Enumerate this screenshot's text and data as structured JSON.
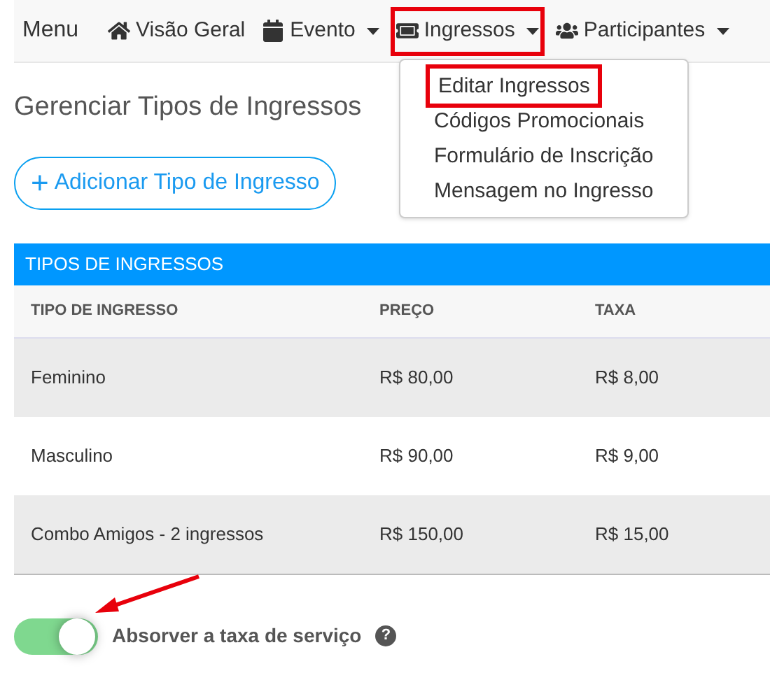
{
  "navbar": {
    "brand": "Menu",
    "items": [
      {
        "label": "Visão Geral",
        "dropdown": false,
        "highlighted": false
      },
      {
        "label": "Evento",
        "dropdown": true,
        "highlighted": false
      },
      {
        "label": "Ingressos",
        "dropdown": true,
        "highlighted": true
      },
      {
        "label": "Participantes",
        "dropdown": true,
        "highlighted": false
      }
    ]
  },
  "dropdown_menu": {
    "items": [
      {
        "label": "Editar Ingressos",
        "highlighted": true
      },
      {
        "label": "Códigos Promocionais",
        "highlighted": false
      },
      {
        "label": "Formulário de Inscrição",
        "highlighted": false
      },
      {
        "label": "Mensagem no Ingresso",
        "highlighted": false
      }
    ]
  },
  "page_title": "Gerenciar Tipos de Ingressos",
  "add_button": {
    "icon": "+",
    "label": "Adicionar Tipo de Ingresso"
  },
  "table": {
    "title": "TIPOS DE INGRESSOS",
    "columns": [
      "TIPO DE INGRESSO",
      "PREÇO",
      "TAXA"
    ],
    "rows": [
      [
        "Feminino",
        "R$ 80,00",
        "R$ 8,00"
      ],
      [
        "Masculino",
        "R$ 90,00",
        "R$ 9,00"
      ],
      [
        "Combo Amigos - 2 ingressos",
        "R$ 150,00",
        "R$ 15,00"
      ]
    ]
  },
  "service_fee_toggle": {
    "label": "Absorver a taxa de serviço",
    "on": true,
    "help": "?"
  }
}
